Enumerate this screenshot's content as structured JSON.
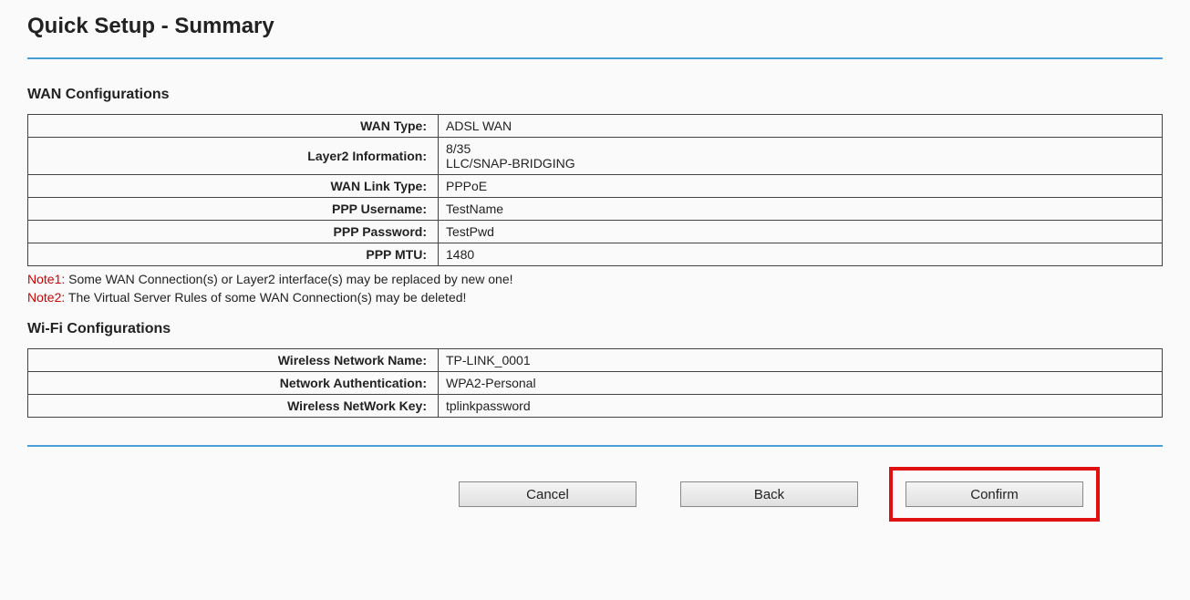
{
  "header": {
    "title": "Quick Setup - Summary"
  },
  "wan": {
    "section_title": "WAN Configurations",
    "rows": {
      "wan_type": {
        "label": "WAN Type:",
        "value": "ADSL WAN"
      },
      "layer2": {
        "label": "Layer2 Information:",
        "value": "8/35\nLLC/SNAP-BRIDGING"
      },
      "link_type": {
        "label": "WAN Link Type:",
        "value": "PPPoE"
      },
      "ppp_user": {
        "label": "PPP Username:",
        "value": "TestName"
      },
      "ppp_pass": {
        "label": "PPP Password:",
        "value": "TestPwd"
      },
      "ppp_mtu": {
        "label": "PPP MTU:",
        "value": "1480"
      }
    }
  },
  "notes": {
    "n1": {
      "label": "Note1:",
      "text": " Some WAN Connection(s) or Layer2 interface(s) may be replaced by new one!"
    },
    "n2": {
      "label": "Note2:",
      "text": " The Virtual Server Rules of some WAN Connection(s) may be deleted!"
    }
  },
  "wifi": {
    "section_title": "Wi-Fi Configurations",
    "rows": {
      "ssid": {
        "label": "Wireless Network Name:",
        "value": "TP-LINK_0001"
      },
      "auth": {
        "label": "Network Authentication:",
        "value": "WPA2-Personal"
      },
      "key": {
        "label": "Wireless NetWork Key:",
        "value": "tplinkpassword"
      }
    }
  },
  "buttons": {
    "cancel": "Cancel",
    "back": "Back",
    "confirm": "Confirm"
  }
}
